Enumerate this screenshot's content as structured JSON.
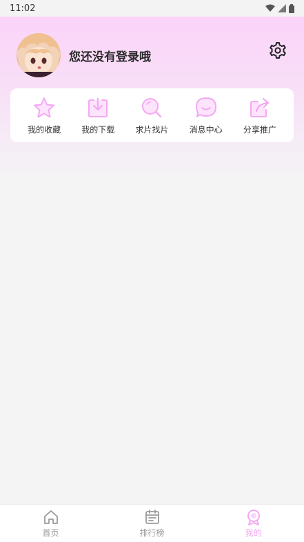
{
  "status_bar": {
    "time": "11:02"
  },
  "profile": {
    "login_prompt": "您还没有登录哦"
  },
  "quick_actions": [
    {
      "label": "我的收藏",
      "icon": "star-icon"
    },
    {
      "label": "我的下载",
      "icon": "download-icon"
    },
    {
      "label": "求片找片",
      "icon": "search-icon"
    },
    {
      "label": "消息中心",
      "icon": "message-icon"
    },
    {
      "label": "分享推广",
      "icon": "share-icon"
    }
  ],
  "bottom_nav": [
    {
      "label": "首页",
      "icon": "home-icon",
      "active": false
    },
    {
      "label": "排行榜",
      "icon": "calendar-icon",
      "active": false
    },
    {
      "label": "我的",
      "icon": "profile-badge-icon",
      "active": true
    }
  ],
  "colors": {
    "accent": "#f4a8f2",
    "header_top": "#fcd0fb"
  }
}
